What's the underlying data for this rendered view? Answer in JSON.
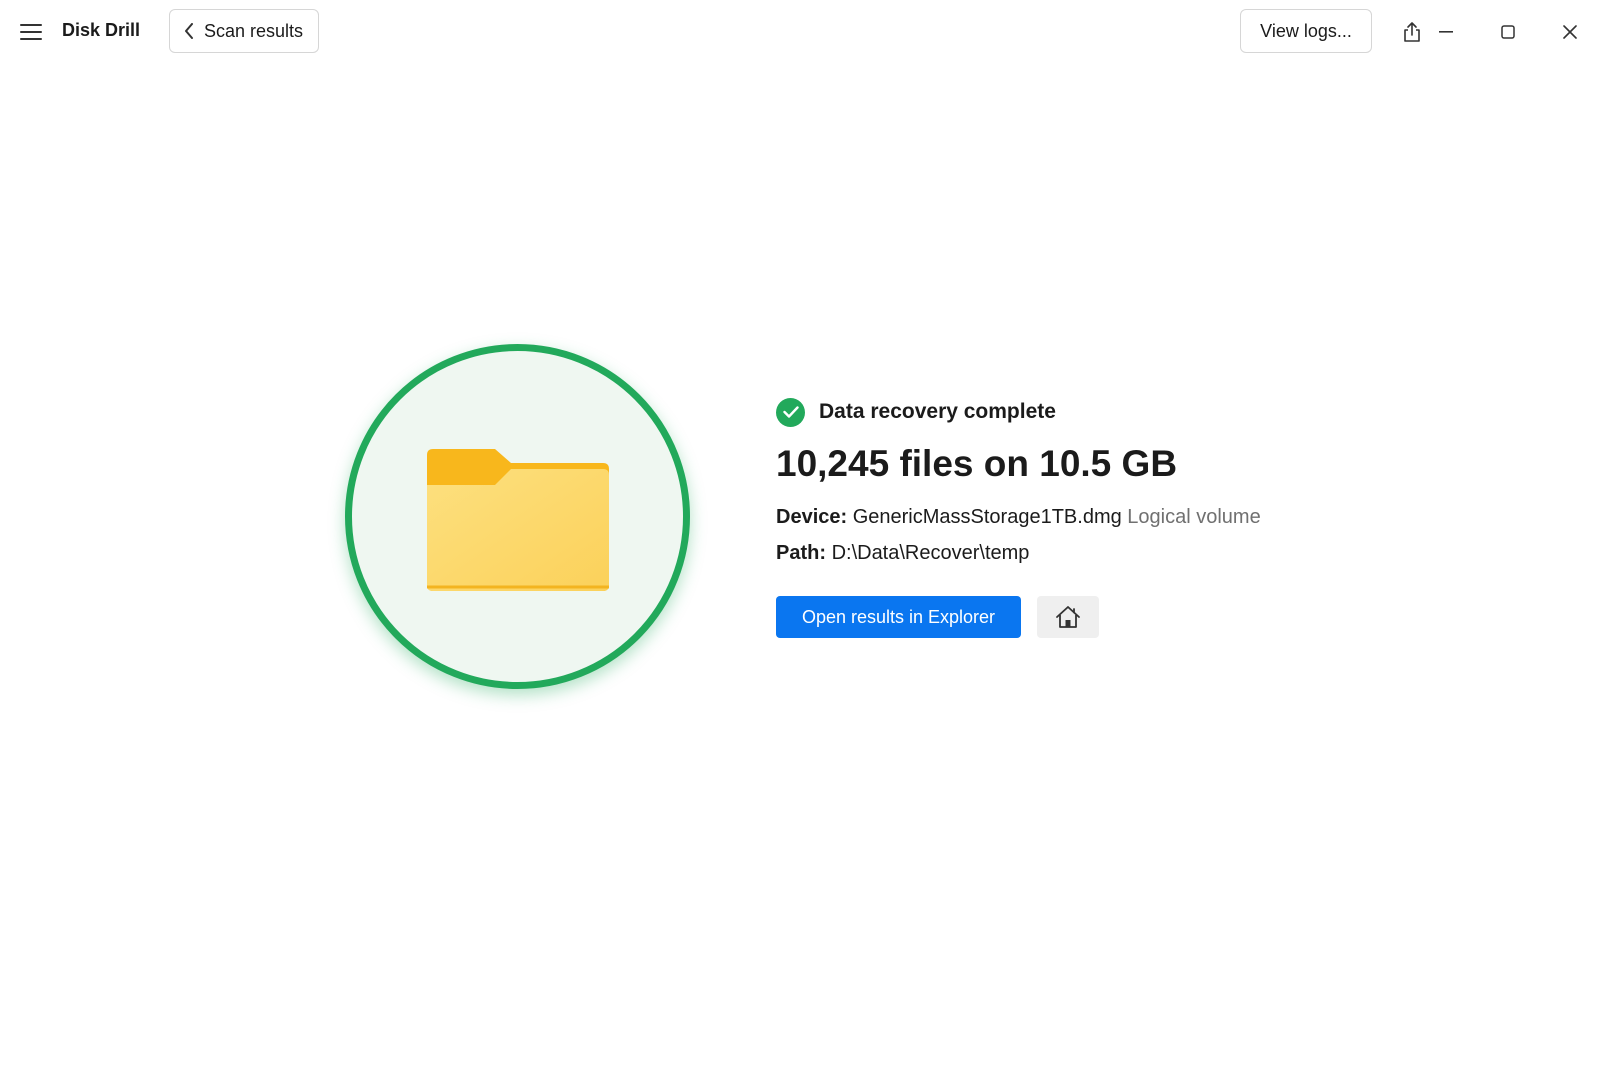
{
  "app": {
    "title": "Disk Drill"
  },
  "header": {
    "back_label": "Scan results",
    "logs_label": "View logs...",
    "icons": [
      "hamburger-menu-icon",
      "chevron-left-icon",
      "share-icon",
      "minimize-icon",
      "maximize-icon",
      "close-icon"
    ]
  },
  "result": {
    "status": "Data recovery complete",
    "headline": "10,245 files on 10.5 GB",
    "device_label": "Device:",
    "device_value": "GenericMassStorage1TB.dmg",
    "device_type": "Logical volume",
    "path_label": "Path:",
    "path_value": "D:\\Data\\Recover\\temp"
  },
  "actions": {
    "open_label": "Open results in Explorer",
    "home_icon": "home-icon"
  },
  "colors": {
    "accent_blue": "#0a76f0",
    "success_green": "#22a95b",
    "folder_yellow": "#fcd35b"
  }
}
